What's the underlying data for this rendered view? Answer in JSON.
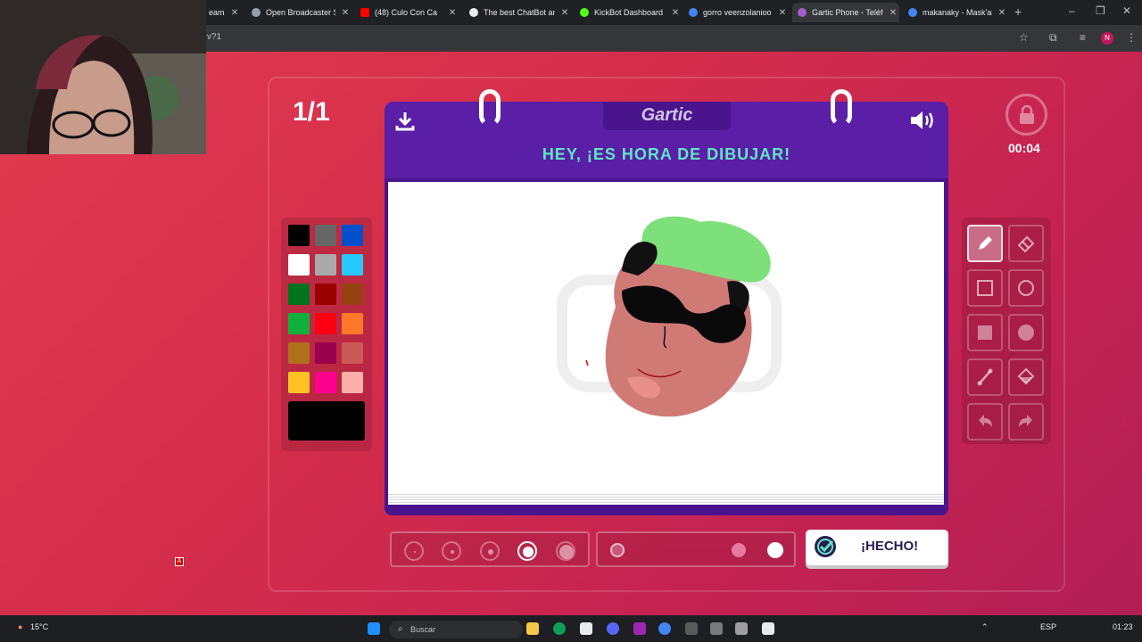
{
  "browser": {
    "tabs": [
      {
        "title": "eam",
        "icon": "obs-icon"
      },
      {
        "title": "Open Broadcaster Sc",
        "icon": "globe-icon"
      },
      {
        "title": "(48) Culo Con Ca",
        "icon": "youtube-icon"
      },
      {
        "title": "The best ChatBot an",
        "icon": "chatbot-icon"
      },
      {
        "title": "KickBot Dashboard",
        "icon": "kickbot-icon"
      },
      {
        "title": "gorro veenzolanioo",
        "icon": "google-icon"
      },
      {
        "title": "Gartic Phone - Teléfo",
        "icon": "gartic-icon"
      },
      {
        "title": "makanaky - Mask'an",
        "icon": "google-icon"
      }
    ],
    "url": "v?1",
    "profile_initial": "N"
  },
  "game": {
    "round": "1/1",
    "logo": "Gartic",
    "title": "HEY, ¡ES HORA DE DIBUJAR!",
    "timer": "00:04",
    "done_label": "¡HECHO!",
    "palette": [
      "#000000",
      "#666666",
      "#0050cd",
      "#ffffff",
      "#aaaaaa",
      "#26c9ff",
      "#017420",
      "#990000",
      "#964112",
      "#11b03c",
      "#ff0013",
      "#ff7829",
      "#b0701c",
      "#99004e",
      "#cb5a57",
      "#ffc126",
      "#ff008f",
      "#feafa8"
    ],
    "selected_color": "#000000",
    "tools": [
      "pencil-icon",
      "eraser-icon",
      "square-outline-icon",
      "circle-outline-icon",
      "square-filled-icon",
      "circle-filled-icon",
      "line-icon",
      "fill-bucket-icon",
      "undo-icon",
      "redo-icon"
    ],
    "active_tool": "pencil-icon",
    "brush_sizes": 5,
    "selected_size_index": 3,
    "opacity": 0.85
  },
  "taskbar": {
    "weather": "15°C",
    "search_placeholder": "Buscar",
    "language": "ESP",
    "time": "01:23"
  },
  "recording_marker": "A"
}
